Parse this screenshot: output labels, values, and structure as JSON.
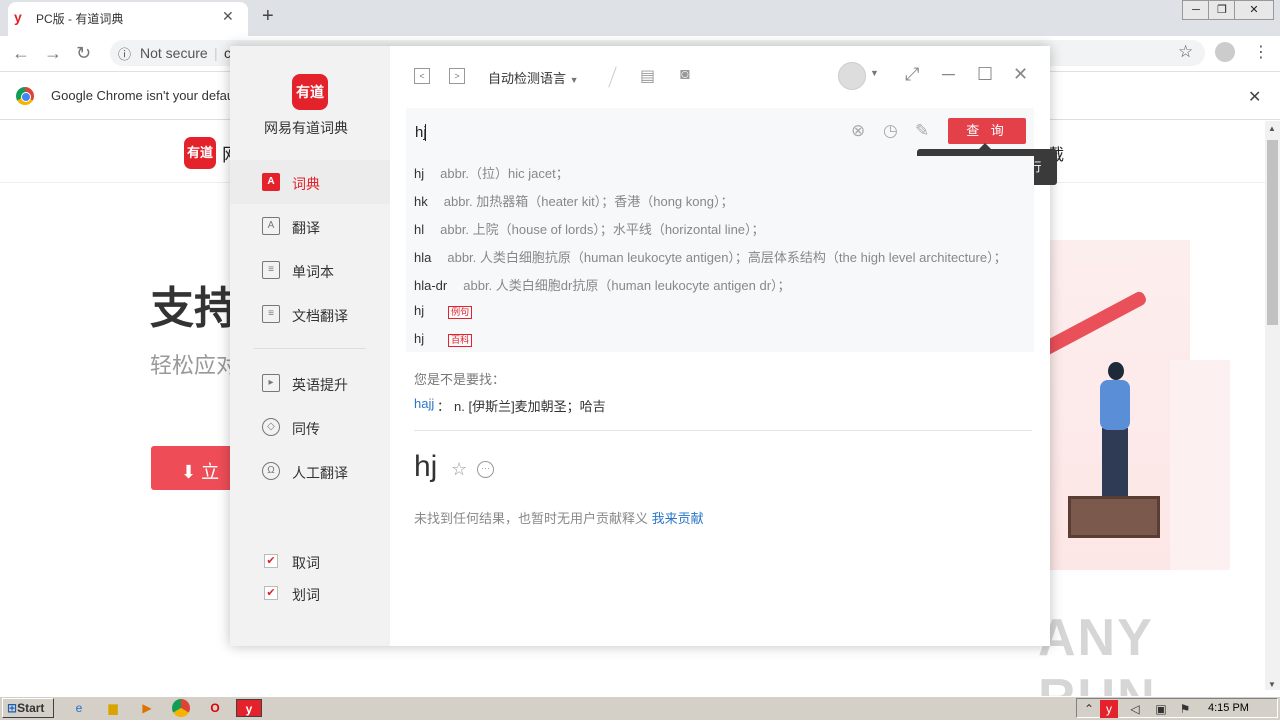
{
  "browser": {
    "tab_title": "PC版 - 有道词典",
    "tab_favicon": "y",
    "insecure_label": "Not secure",
    "url_fragment": "c",
    "default_browser_msg": "Google Chrome isn't your default"
  },
  "website": {
    "logo_text": "有道",
    "logo_trail": "网",
    "nav_end": "载",
    "hero_title": "支持",
    "hero_sub": "轻松应对",
    "download_btn": "立"
  },
  "app": {
    "logo_text": "有道",
    "name": "网易有道词典",
    "sidebar": [
      {
        "label": "词典",
        "icon": "A",
        "active": true
      },
      {
        "label": "翻译",
        "icon": "A"
      },
      {
        "label": "单词本",
        "icon": "≡"
      },
      {
        "label": "文档翻译",
        "icon": "≡"
      },
      {
        "label": "英语提升",
        "icon": "▸"
      },
      {
        "label": "同传",
        "icon": "◇"
      },
      {
        "label": "人工翻译",
        "icon": "Ω"
      }
    ],
    "toggles": [
      {
        "label": "取词",
        "checked": true
      },
      {
        "label": "划词",
        "checked": true
      }
    ],
    "language_select": "自动检测语言",
    "search": {
      "value": "hj",
      "button": "查 询",
      "tooltip": "按 Ctrl+Enter 键换行"
    },
    "suggestions": [
      {
        "word": "hj",
        "def": "abbr.（拉）hic jacet；"
      },
      {
        "word": "hk",
        "def": "abbr. 加热器箱（heater kit）；香港（hong kong）；"
      },
      {
        "word": "hl",
        "def": "abbr. 上院（house of lords）；水平线（horizontal line）；"
      },
      {
        "word": "hla",
        "def": "abbr. 人类白细胞抗原（human leukocyte antigen）；高层体系结构（the high level architecture）；"
      },
      {
        "word": "hla-dr",
        "def": "abbr. 人类白细胞dr抗原（human leukocyte antigen dr）；"
      },
      {
        "word": "hj",
        "tag": "例句"
      },
      {
        "word": "hj",
        "tag": "百科"
      }
    ],
    "did_you_mean": {
      "title": "您是不是要找：",
      "word": "hajj",
      "sep": "：",
      "def": "n. [伊斯兰]麦加朝圣；哈吉"
    },
    "result": {
      "word": "hj",
      "no_result": "未找到任何结果，也暂时无用户贡献释义",
      "contribute": "我来贡献"
    }
  },
  "taskbar": {
    "start": "Start",
    "clock": "4:15 PM"
  },
  "watermark": "ANY RUN",
  "colors": {
    "brand_red": "#e4222b",
    "link_blue": "#2a77c9"
  }
}
